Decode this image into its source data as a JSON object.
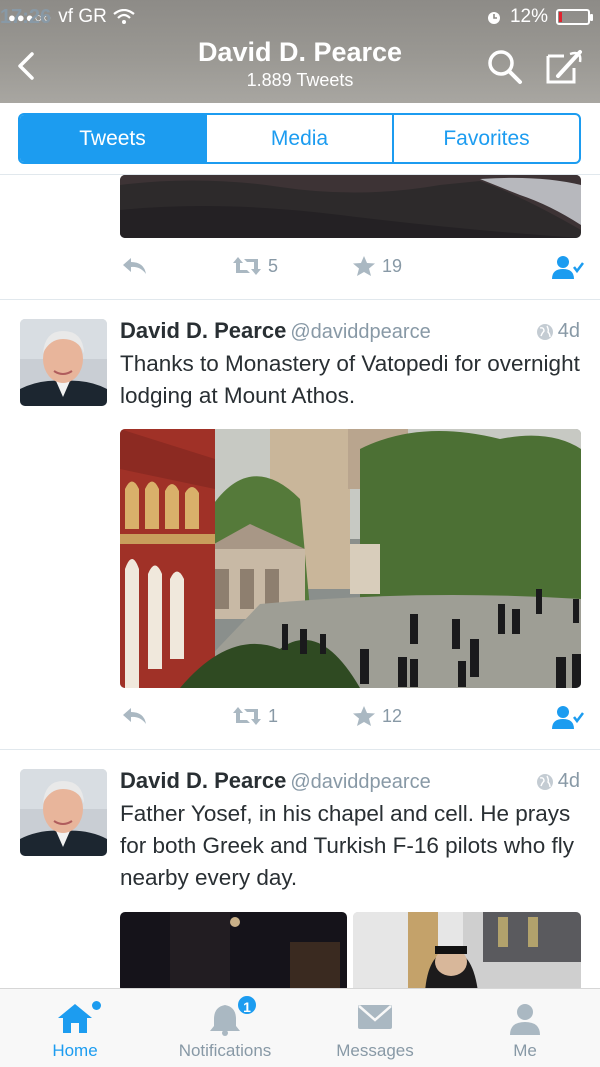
{
  "status_bar": {
    "carrier": "vf GR",
    "time": "17:26",
    "battery": "12%",
    "battery_level": 0.12,
    "icons": [
      "signal-dots-icon",
      "wifi-icon",
      "alarm-icon",
      "battery-icon"
    ]
  },
  "nav": {
    "title": "David D. Pearce",
    "subtitle": "1.889 Tweets",
    "icons": [
      "back-chevron-icon",
      "search-icon",
      "compose-icon"
    ]
  },
  "tabs": [
    {
      "label": "Tweets",
      "active": true
    },
    {
      "label": "Media",
      "active": false
    },
    {
      "label": "Favorites",
      "active": false
    }
  ],
  "tweets": [
    {
      "partial": true,
      "actions": {
        "retweets": "5",
        "favorites": "19"
      }
    },
    {
      "name": "David D. Pearce",
      "handle": "@daviddpearce",
      "time": "4d",
      "text": "Thanks to Monastery of Vatopedi for overnight lodging at Mount Athos.",
      "actions": {
        "retweets": "1",
        "favorites": "12"
      }
    },
    {
      "name": "David D. Pearce",
      "handle": "@daviddpearce",
      "time": "4d",
      "text": "Father Yosef, in his chapel and cell.  He prays for both Greek and Turkish F-16 pilots who fly nearby every day."
    }
  ],
  "tabbar": [
    {
      "label": "Home",
      "icon": "home-icon",
      "active": true
    },
    {
      "label": "Notifications",
      "icon": "notifications-bell-icon",
      "badge": "1"
    },
    {
      "label": "Messages",
      "icon": "messages-envelope-icon"
    },
    {
      "label": "Me",
      "icon": "me-person-icon"
    }
  ],
  "colors": {
    "accent": "#1c9cf0",
    "header_bg": "#9a9893",
    "muted_text": "#8899a6",
    "body_text": "#292f33"
  }
}
